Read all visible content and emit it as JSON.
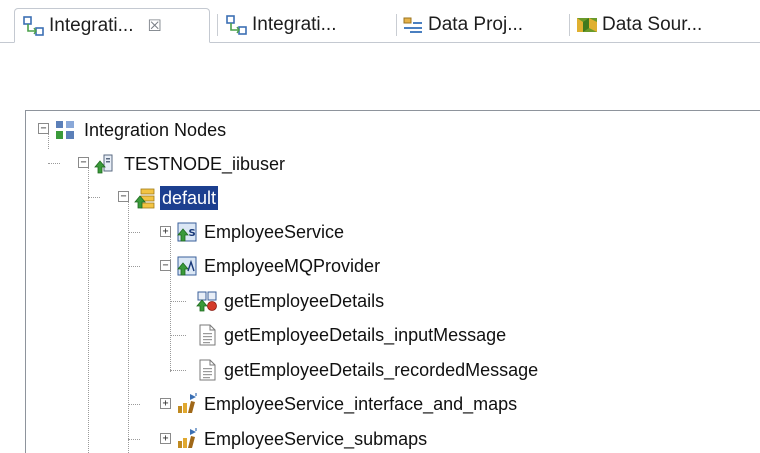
{
  "tabs": [
    {
      "label": "Integrati...",
      "icon": "integration-nodes-icon",
      "active": true,
      "closable": true,
      "close_glyph": "☒"
    },
    {
      "label": "Integrati...",
      "icon": "integration-nodes-icon",
      "active": false
    },
    {
      "label": "Data Proj...",
      "icon": "data-project-icon",
      "active": false
    },
    {
      "label": "Data Sour...",
      "icon": "data-source-icon",
      "active": false
    }
  ],
  "tree": {
    "root": {
      "label": "Integration Nodes",
      "expander": "−"
    },
    "node": {
      "label": "TESTNODE_iibuser",
      "expander": "−"
    },
    "server": {
      "label": "default",
      "expander": "−",
      "selected": true
    },
    "items": [
      {
        "label": "EmployeeService",
        "expander": "+"
      },
      {
        "label": "EmployeeMQProvider",
        "expander": "−"
      },
      {
        "label": "getEmployeeDetails"
      },
      {
        "label": "getEmployeeDetails_inputMessage"
      },
      {
        "label": "getEmployeeDetails_recordedMessage"
      },
      {
        "label": "EmployeeService_interface_and_maps",
        "expander": "+"
      },
      {
        "label": "EmployeeService_submaps",
        "expander": "+"
      }
    ]
  },
  "colors": {
    "selection": "#1c3f8f",
    "accent_green": "#3a9a3a",
    "border": "#c4c9d1"
  }
}
